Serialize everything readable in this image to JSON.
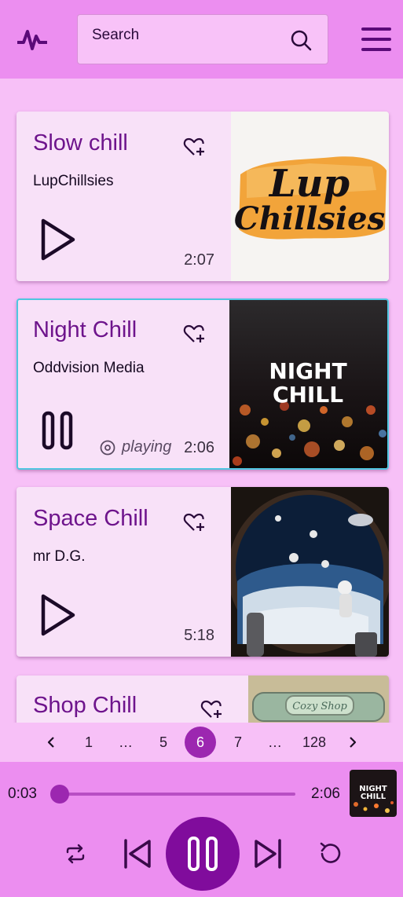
{
  "search": {
    "placeholder": "Search"
  },
  "tracks": [
    {
      "title": "Slow chill",
      "artist": "LupChillsies",
      "duration": "2:07",
      "state": "paused",
      "art_text_1": "Lup",
      "art_text_2": "Chillsies"
    },
    {
      "title": "Night Chill",
      "artist": "Oddvision Media",
      "duration": "2:06",
      "state": "playing",
      "status": "playing",
      "art_text_1": "NIGHT",
      "art_text_2": "CHILL"
    },
    {
      "title": "Space Chill",
      "artist": "mr D.G.",
      "duration": "5:18",
      "state": "paused"
    },
    {
      "title": "Shop Chill",
      "artist": "",
      "duration": "",
      "state": "paused",
      "art_text_1": "Cozy Shop"
    }
  ],
  "pagination": {
    "items": [
      "1",
      "…",
      "5",
      "6",
      "7",
      "…",
      "128"
    ],
    "current": "6"
  },
  "player": {
    "elapsed": "0:03",
    "total": "2:06",
    "progress": 0.02,
    "art_text_1": "NIGHT",
    "art_text_2": "CHILL"
  },
  "colors": {
    "header_bg": "#ec8ef0",
    "page_bg": "#f7c0f7",
    "card_bg": "#f8e1f8",
    "accent": "#9c27b0",
    "title": "#6e148c",
    "active_border": "#4fc6e0"
  }
}
